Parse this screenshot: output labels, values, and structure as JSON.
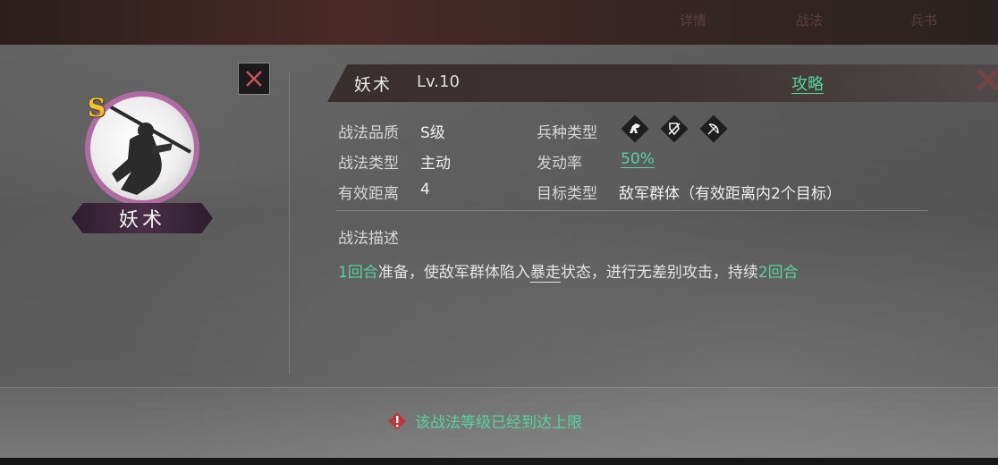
{
  "background": {
    "menu_ghost": [
      "详情",
      "战法",
      "兵书"
    ]
  },
  "skill": {
    "grade_badge": "S",
    "name": "妖术",
    "name_plate": "妖术",
    "level": "Lv.10",
    "guide_link": "攻略"
  },
  "attributes": {
    "quality_label": "战法品质",
    "quality_value": "S级",
    "type_label": "战法类型",
    "type_value": "主动",
    "range_label": "有效距离",
    "range_value": "4",
    "troop_label": "兵种类型",
    "troop_icons": [
      "cavalry-icon",
      "shield-icon",
      "bow-icon"
    ],
    "rate_label": "发动率",
    "rate_value": "50%",
    "target_label": "目标类型",
    "target_value": "敌军群体（有效距离内2个目标）"
  },
  "description": {
    "heading": "战法描述",
    "prep_turns": "1回合",
    "part1": "准备，使敌军群体陷入",
    "status_word": "暴走",
    "part2": "状态，进行无差别攻击，持续",
    "duration": "2回合"
  },
  "footer": {
    "limit_message": "该战法等级已经到达上限"
  },
  "colors": {
    "accent_green": "#55d2a4",
    "avatar_ring": "#b06aa4",
    "grade_gold": "#f2c232",
    "close_red": "#c9545a"
  }
}
